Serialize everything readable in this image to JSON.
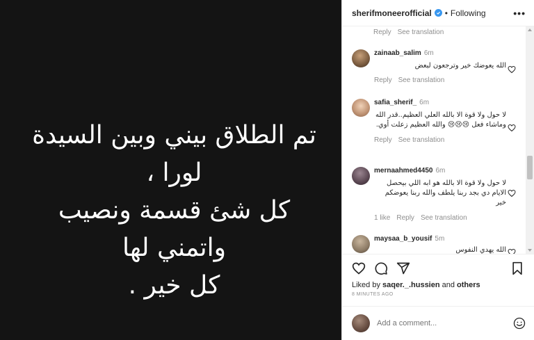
{
  "post": {
    "image_text": "تم الطلاق بيني وبين السيدة لورا ،\nكل شئ قسمة ونصيب  واتمني لها\nكل خير ."
  },
  "header": {
    "username": "sherifmoneerofficial",
    "separator": "•",
    "follow_status": "Following",
    "more_label": "•••"
  },
  "first_meta": {
    "reply": "Reply",
    "translation": "See translation"
  },
  "comments": [
    {
      "user": "zainaab_salim",
      "time": "6m",
      "text": "الله يعوضك خير وترجعون لبعض",
      "reply": "Reply",
      "translation": "See translation",
      "avatar_color": "#7a5b3f"
    },
    {
      "user": "safia_sherif_",
      "time": "6m",
      "text": "لا حول ولا قوة الا بالله العلي العظيم..قدر الله وماشاء فعل 😢😢😢 والله العظيم زعلت أوي.",
      "reply": "Reply",
      "translation": "See translation",
      "avatar_color": "#c29677"
    },
    {
      "user": "mernaahmed4450",
      "time": "6m",
      "text": "لا حول ولا قوة الا بالله هو ابه اللي بيحصل الايام دي بجد ربنا يلطف والله ربنا يعوضكم خير",
      "likes": "1 like",
      "reply": "Reply",
      "translation": "See translation",
      "avatar_color": "#5a4752"
    },
    {
      "user": "maysaa_b_yousif",
      "time": "5m",
      "text": "الله يهدي النفوس",
      "avatar_color": "#8d7b66"
    }
  ],
  "actions": {
    "likes_prefix": "Liked by ",
    "likes_user": "saqer._.hussien",
    "likes_middle": " and ",
    "likes_others": "others",
    "time_ago": "8 MINUTES AGO"
  },
  "add_comment": {
    "placeholder": "Add a comment..."
  },
  "icons": {
    "verified": "verified-badge-icon",
    "heart": "heart-icon",
    "comment": "comment-icon",
    "share": "share-icon",
    "bookmark": "bookmark-icon",
    "emoji": "emoji-icon"
  },
  "colors": {
    "verified": "#3897f0",
    "image_bg": "#141414",
    "muted": "#8e8e8e"
  }
}
